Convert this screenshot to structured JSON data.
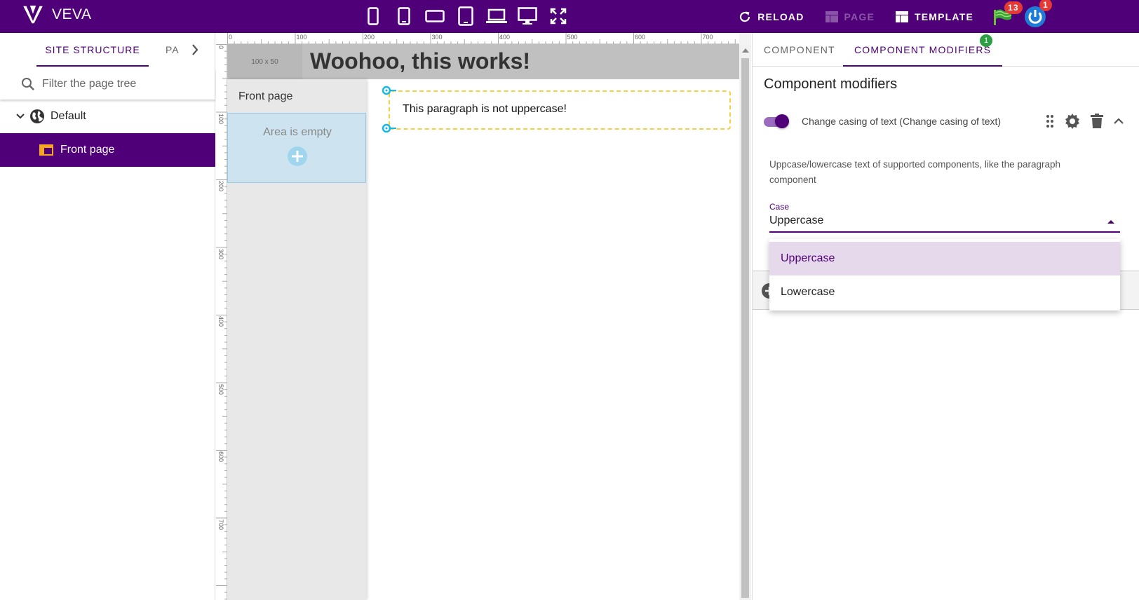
{
  "app": {
    "name": "VEVA"
  },
  "topbar": {
    "devices": [
      "phone-small-icon",
      "phone-icon",
      "phone-landscape-icon",
      "tablet-icon",
      "laptop-icon",
      "desktop-icon",
      "fullscreen-icon"
    ],
    "reload_label": "RELOAD",
    "page_label": "PAGE",
    "template_label": "TEMPLATE",
    "flag_badge": "13",
    "power_badge": "1"
  },
  "left": {
    "tab_active": "SITE STRUCTURE",
    "tab_other": "PA",
    "search_placeholder": "Filter the page tree",
    "tree": {
      "root": "Default",
      "page": "Front page"
    }
  },
  "canvas": {
    "ruler_x": [
      "0",
      "100",
      "200",
      "300",
      "400",
      "500",
      "600",
      "700"
    ],
    "ruler_y": [
      "0",
      "100",
      "200",
      "300",
      "400",
      "500",
      "600",
      "700"
    ],
    "size_label": "100 x 50",
    "heading": "Woohoo, this works!",
    "side_title": "Front page",
    "empty_text": "Area is empty",
    "paragraph": "This paragraph is not uppercase!"
  },
  "right": {
    "tab_component": "COMPONENT",
    "tab_modifiers": "COMPONENT MODIFIERS",
    "modifiers_badge": "1",
    "title": "Component modifiers",
    "modifier": {
      "title": "Change casing of text (Change casing of text)",
      "enabled": true,
      "description": "Uppcase/lowercase text of supported components, like the paragraph component",
      "field_label": "Case",
      "field_value": "Uppercase",
      "options": [
        "Uppercase",
        "Lowercase"
      ]
    }
  },
  "colors": {
    "brand": "#4f0078",
    "badge_red": "#e53935",
    "badge_green": "#2e9e44",
    "outline_yellow": "#f5d142",
    "handle_cyan": "#17b7e6"
  }
}
